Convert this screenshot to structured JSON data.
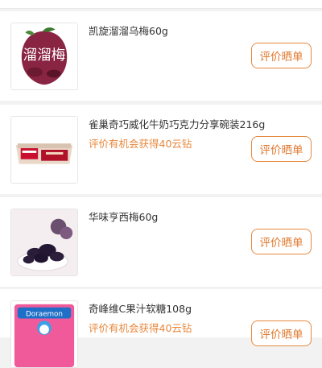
{
  "orders": [
    {
      "name": "凯旋溜溜乌梅60g",
      "hint": "",
      "button_label": "评价晒单",
      "image_text": "溜溜梅"
    },
    {
      "name": "雀巢奇巧威化牛奶巧克力分享碗装216g",
      "hint": "评价有机会获得40云钻",
      "button_label": "评价晒单",
      "image_text": ""
    },
    {
      "name": "华味亨西梅60g",
      "hint": "",
      "button_label": "评价晒单",
      "image_text": ""
    },
    {
      "name": "奇峰维C果汁软糖108g",
      "hint": "评价有机会获得40云钻",
      "button_label": "评价晒单",
      "image_text": "Doraemon"
    }
  ]
}
